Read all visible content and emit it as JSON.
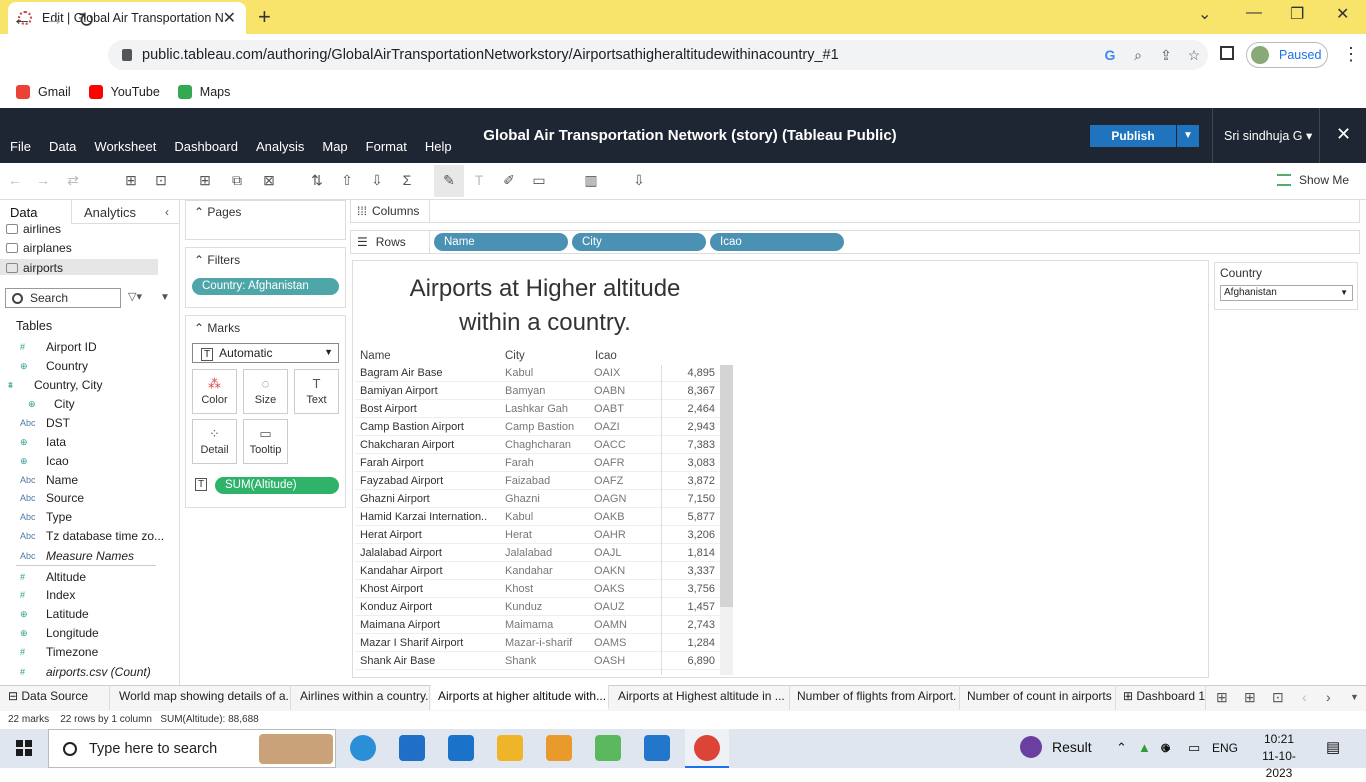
{
  "browser": {
    "tab_title": "Edit | Global Air Transportation N",
    "url": "public.tableau.com/authoring/GlobalAirTransportationNetworkstory/Airportsathigheraltitudewithinacountry_#1",
    "profile_status": "Paused",
    "bookmarks": [
      "Gmail",
      "YouTube",
      "Maps"
    ]
  },
  "app": {
    "menu": [
      "File",
      "Data",
      "Worksheet",
      "Dashboard",
      "Analysis",
      "Map",
      "Format",
      "Help"
    ],
    "title": "Global Air Transportation Network (story) (Tableau Public)",
    "publish_label": "Publish",
    "user": "Sri sindhuja G",
    "show_me": "Show Me"
  },
  "datapane": {
    "tab_data": "Data",
    "tab_analytics": "Analytics",
    "sources": [
      "airlines",
      "airplanes",
      "airports"
    ],
    "search_placeholder": "Search",
    "tables_heading": "Tables",
    "fields": [
      {
        "icon": "#",
        "name": "Airport ID"
      },
      {
        "icon": "⊕",
        "name": "Country"
      },
      {
        "icon": "⩩",
        "name": "Country, City"
      },
      {
        "icon": "⊕",
        "name": "City"
      },
      {
        "icon": "Abc",
        "name": "DST"
      },
      {
        "icon": "⊕",
        "name": "Iata"
      },
      {
        "icon": "⊕",
        "name": "Icao"
      },
      {
        "icon": "Abc",
        "name": "Name"
      },
      {
        "icon": "Abc",
        "name": "Source"
      },
      {
        "icon": "Abc",
        "name": "Type"
      },
      {
        "icon": "Abc",
        "name": "Tz database time zo..."
      },
      {
        "icon": "Abc",
        "name": "Measure Names"
      }
    ],
    "measures": [
      {
        "icon": "#",
        "name": "Altitude"
      },
      {
        "icon": "#",
        "name": "Index"
      },
      {
        "icon": "⊕",
        "name": "Latitude"
      },
      {
        "icon": "⊕",
        "name": "Longitude"
      },
      {
        "icon": "#",
        "name": "Timezone"
      },
      {
        "icon": "#",
        "name": "airports.csv (Count)"
      }
    ]
  },
  "cards": {
    "pages": "Pages",
    "filters": "Filters",
    "filter_pill": "Country: Afghanistan",
    "marks": "Marks",
    "mark_type": "Automatic",
    "buttons": [
      "Color",
      "Size",
      "Text",
      "Detail",
      "Tooltip"
    ],
    "marks_pill": "SUM(Altitude)"
  },
  "shelves": {
    "columns": "Columns",
    "rows": "Rows",
    "row_pills": [
      "Name",
      "City",
      "Icao"
    ]
  },
  "viz": {
    "title_line1": "Airports at Higher altitude",
    "title_line2": "within a country.",
    "headers": [
      "Name",
      "City",
      "Icao"
    ],
    "rows": [
      [
        "Bagram Air Base",
        "Kabul",
        "OAIX",
        "4,895"
      ],
      [
        "Bamiyan Airport",
        "Bamyan",
        "OABN",
        "8,367"
      ],
      [
        "Bost Airport",
        "Lashkar Gah",
        "OABT",
        "2,464"
      ],
      [
        "Camp Bastion Airport",
        "Camp Bastion",
        "OAZI",
        "2,943"
      ],
      [
        "Chakcharan Airport",
        "Chaghcharan",
        "OACC",
        "7,383"
      ],
      [
        "Farah Airport",
        "Farah",
        "OAFR",
        "3,083"
      ],
      [
        "Fayzabad Airport",
        "Faizabad",
        "OAFZ",
        "3,872"
      ],
      [
        "Ghazni Airport",
        "Ghazni",
        "OAGN",
        "7,150"
      ],
      [
        "Hamid Karzai Internation..",
        "Kabul",
        "OAKB",
        "5,877"
      ],
      [
        "Herat Airport",
        "Herat",
        "OAHR",
        "3,206"
      ],
      [
        "Jalalabad Airport",
        "Jalalabad",
        "OAJL",
        "1,814"
      ],
      [
        "Kandahar Airport",
        "Kandahar",
        "OAKN",
        "3,337"
      ],
      [
        "Khost Airport",
        "Khost",
        "OAKS",
        "3,756"
      ],
      [
        "Konduz Airport",
        "Kunduz",
        "OAUZ",
        "1,457"
      ],
      [
        "Maimana Airport",
        "Maimama",
        "OAMN",
        "2,743"
      ],
      [
        "Mazar I Sharif Airport",
        "Mazar-i-sharif",
        "OAMS",
        "1,284"
      ],
      [
        "Shank Air Base",
        "Shank",
        "OASH",
        "6,890"
      ]
    ],
    "filter_card_title": "Country",
    "filter_card_value": "Afghanistan"
  },
  "sheet_tabs": [
    "Data Source",
    "World map showing details of a...",
    "Airlines within a country.",
    "Airports at higher altitude with...",
    "Airports at Highest altitude in ...",
    "Number of flights from Airport.",
    "Number of count in airports",
    "Dashboard 1"
  ],
  "status": {
    "marks": "22 marks",
    "rows": "22 rows by 1 column",
    "sum": "SUM(Altitude): 88,688"
  },
  "taskbar": {
    "search_placeholder": "Type here to search",
    "result": "Result",
    "lang": "ENG",
    "time": "10:21",
    "date": "11-10-2023"
  }
}
